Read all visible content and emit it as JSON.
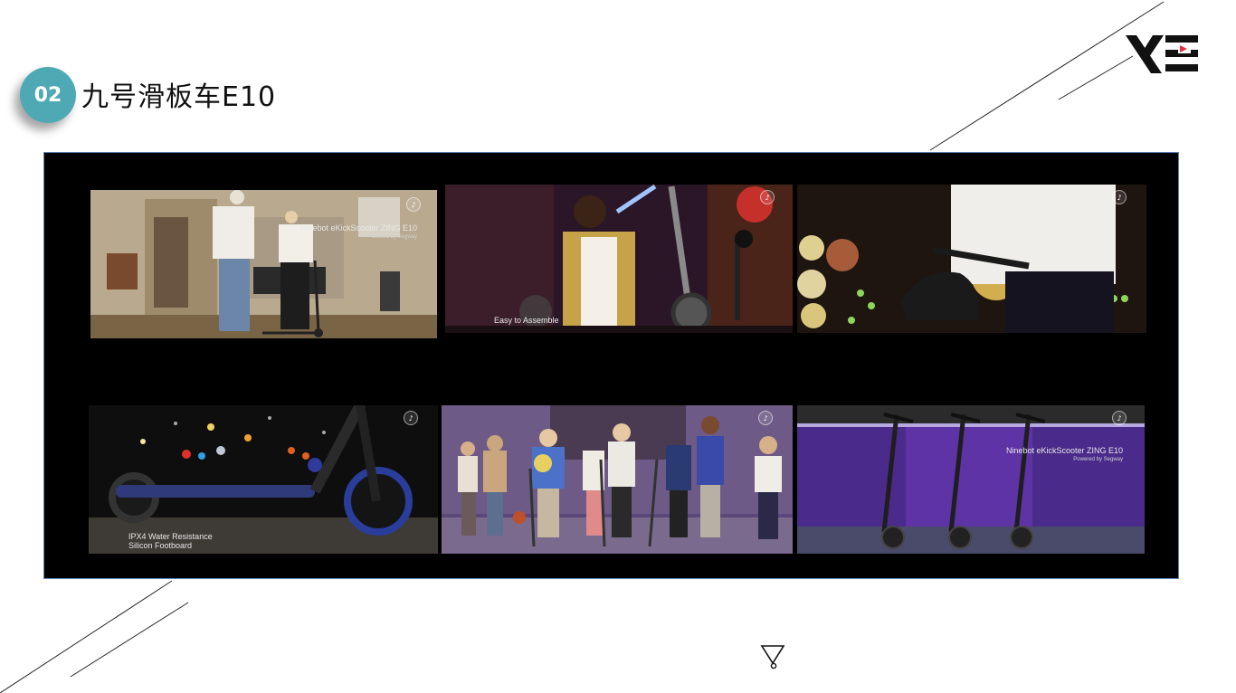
{
  "slide": {
    "number": "02",
    "title": "九号滑板车E10"
  },
  "colors": {
    "badge": "#4fa9b4",
    "frame_border": "#5b7fb5",
    "logo_red": "#e0303a"
  },
  "icons": {
    "logo": "ve-logo-icon",
    "segway_watermark": "segway-watermark-icon",
    "funnel": "funnel-icon"
  },
  "thumbnails": [
    {
      "caption": "Ninebot eKickScooter ZING E10",
      "sub": "Powered by Segway"
    },
    {
      "caption": "Easy to Assemble",
      "sub": ""
    },
    {
      "caption": "",
      "sub": ""
    },
    {
      "caption": "IPX4 Water Resistance",
      "sub": "Silicon Footboard"
    },
    {
      "caption": "",
      "sub": ""
    },
    {
      "caption": "Ninebot eKickScooter ZING E10",
      "sub": "Powered by Segway"
    }
  ]
}
